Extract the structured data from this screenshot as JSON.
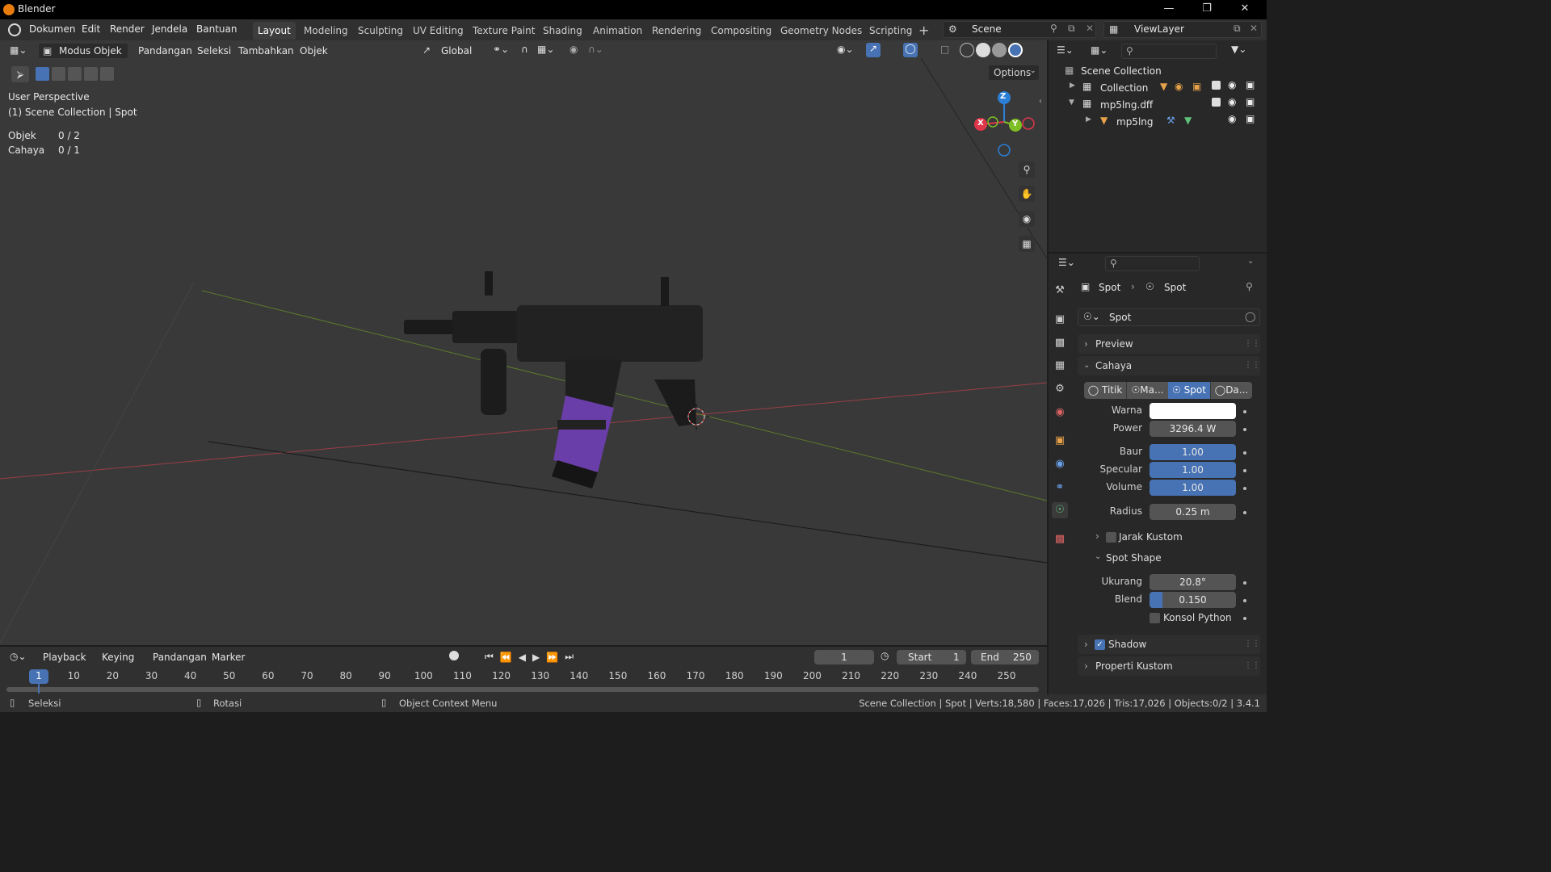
{
  "titlebar": {
    "app_title": "Blender"
  },
  "menu": {
    "items": [
      "Dokumen",
      "Edit",
      "Render",
      "Jendela",
      "Bantuan"
    ]
  },
  "workspaces": [
    "Layout",
    "Modeling",
    "Sculpting",
    "UV Editing",
    "Texture Paint",
    "Shading",
    "Animation",
    "Rendering",
    "Compositing",
    "Geometry Nodes",
    "Scripting"
  ],
  "active_workspace": "Layout",
  "scene": {
    "name": "Scene",
    "view_layer": "ViewLayer"
  },
  "viewport_header": {
    "mode": "Modus Objek",
    "menus": [
      "Pandangan",
      "Seleksi",
      "Tambahkan",
      "Objek"
    ],
    "transform_orientation": "Global",
    "options_label": "Options"
  },
  "viewport_overlay": {
    "perspective": "User Perspective",
    "collection_path": "(1) Scene Collection | Spot",
    "stats": [
      {
        "label": "Objek",
        "value": "0 / 2"
      },
      {
        "label": "Cahaya",
        "value": "0 / 1"
      }
    ]
  },
  "gizmo": {
    "x": "X",
    "y": "Y",
    "z": "Z"
  },
  "outliner": {
    "root": "Scene Collection",
    "items": [
      {
        "name": "Collection",
        "depth": 1
      },
      {
        "name": "mp5lng.dff",
        "depth": 1
      },
      {
        "name": "mp5lng",
        "depth": 2
      }
    ]
  },
  "properties": {
    "breadcrumb_object": "Spot",
    "breadcrumb_data": "Spot",
    "datablock_name": "Spot",
    "panels": {
      "preview": "Preview",
      "light": "Cahaya",
      "custom_distance": "Jarak Kustom",
      "spot_shape": "Spot Shape",
      "shadow": "Shadow",
      "custom_props": "Properti Kustom"
    },
    "light_types": [
      "Titik",
      "Ma...",
      "Spot",
      "Da..."
    ],
    "active_light_type": "Spot",
    "fields": {
      "color_label": "Warna",
      "color_value": "#ffffff",
      "power_label": "Power",
      "power_value": "3296.4 W",
      "diffuse_label": "Baur",
      "diffuse_value": "1.00",
      "specular_label": "Specular",
      "specular_value": "1.00",
      "volume_label": "Volume",
      "volume_value": "1.00",
      "radius_label": "Radius",
      "radius_value": "0.25 m",
      "size_label": "Ukurang",
      "size_value": "20.8°",
      "blend_label": "Blend",
      "blend_value": "0.150",
      "blend_fraction": 0.15,
      "show_cone_label": "Konsol Python"
    }
  },
  "timeline": {
    "menus": [
      "Playback",
      "Keying",
      "Pandangan",
      "Marker"
    ],
    "current_frame": "1",
    "start_label": "Start",
    "start_value": "1",
    "end_label": "End",
    "end_value": "250",
    "ticks": [
      "1",
      "10",
      "20",
      "30",
      "40",
      "50",
      "60",
      "70",
      "80",
      "90",
      "100",
      "110",
      "120",
      "130",
      "140",
      "150",
      "160",
      "170",
      "180",
      "190",
      "200",
      "210",
      "220",
      "230",
      "240",
      "250"
    ]
  },
  "statusbar": {
    "left": "Seleksi",
    "middle": "Rotasi",
    "right": "Object Context Menu",
    "info": "Scene Collection | Spot | Verts:18,580 | Faces:17,026 | Tris:17,026 | Objects:0/2 | 3.4.1"
  },
  "colors": {
    "accent": "#4772b3",
    "x_axis": "#e0364a",
    "y_axis": "#7ebf25",
    "z_axis": "#2b7fd6",
    "magazine": "#6a3ea8"
  }
}
